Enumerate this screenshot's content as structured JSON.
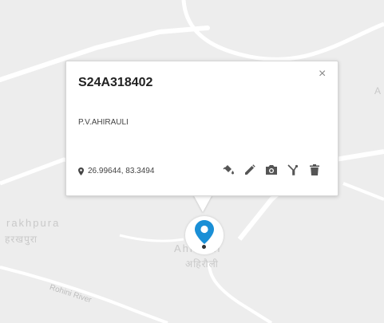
{
  "map": {
    "place_label_en": "rakhpura",
    "place_label_hi": "हरखपुरा",
    "village_label_en": "Ahirauli",
    "village_label_hi": "अहिरौली",
    "river_label": "Rohini River",
    "edge_label": "A",
    "road_color": "#ffffff",
    "background_color": "#ededed"
  },
  "popup": {
    "title": "S24A318402",
    "subtitle": "P.V.AHIRAULI",
    "close_glyph": "×",
    "coordinates": "26.99644, 83.3494",
    "coordinate_icon": "pin-icon",
    "actions": [
      {
        "name": "paint-bucket-icon",
        "label": "Style"
      },
      {
        "name": "pencil-icon",
        "label": "Edit"
      },
      {
        "name": "camera-icon",
        "label": "Photo"
      },
      {
        "name": "filter-icon",
        "label": "Filter"
      },
      {
        "name": "trash-icon",
        "label": "Delete"
      }
    ]
  },
  "marker": {
    "icon": "location-pin-icon",
    "color": "#1a8fd6"
  }
}
